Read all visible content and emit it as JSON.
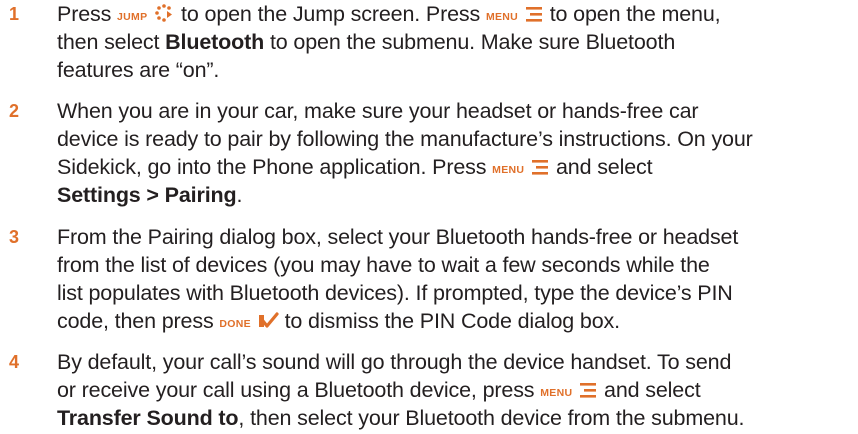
{
  "steps": [
    {
      "number": "1",
      "l1a": "Press ",
      "key_jump": "JUMP",
      "l1b": " to open the Jump screen. Press ",
      "key_menu": "MENU",
      "l1c": " to open the menu,",
      "l2a": "then select ",
      "l2b": "Bluetooth",
      "l2c": " to open the submenu. Make sure Bluetooth",
      "l3": "features are “on”."
    },
    {
      "number": "2",
      "l1": "When you are in your car, make sure your headset or hands-free car",
      "l2": "device is ready to pair by following the manufacture’s instructions. On your",
      "l3a": "Sidekick, go into the Phone application. Press ",
      "key_menu": "MENU",
      "l3b": " and select",
      "l4a": "Settings > Pairing",
      "l4b": "."
    },
    {
      "number": "3",
      "l1": "From the Pairing dialog box, select your Bluetooth hands-free or headset",
      "l2": "from the list of devices (you may have to wait a few seconds while the",
      "l3": "list populates with Bluetooth devices). If prompted, type the device’s PIN",
      "l4a": "code, then press ",
      "key_done": "DONE",
      "l4b": " to dismiss the PIN Code dialog box."
    },
    {
      "number": "4",
      "l1": "By default, your call’s sound will go through the device handset. To send",
      "l2a": "or receive your call using a Bluetooth device, press ",
      "key_menu": "MENU",
      "l2b": " and select",
      "l3a": "Transfer Sound to",
      "l3b": ", then select your Bluetooth device from the submenu."
    }
  ],
  "icons": {
    "jump": "jump-dots-icon",
    "menu": "menu-lines-icon",
    "done": "done-check-icon"
  },
  "colors": {
    "accent": "#e0702a",
    "text": "#231f20"
  }
}
